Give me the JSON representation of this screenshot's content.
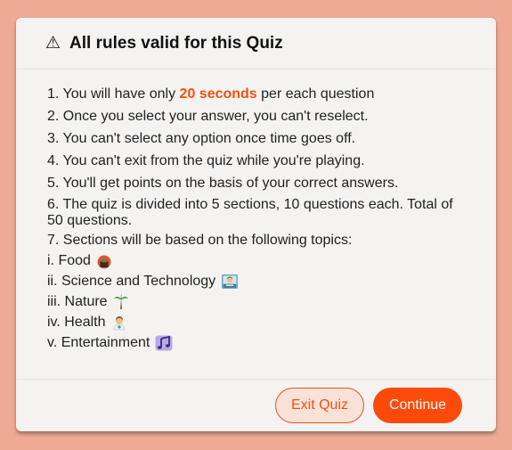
{
  "dialog": {
    "title": "All rules valid for this Quiz",
    "rules": {
      "r1_prefix": "1. You will have only ",
      "r1_highlight": "20 seconds",
      "r1_suffix": " per each question",
      "r2": "2. Once you select your answer, you can't reselect.",
      "r3": "3. You can't select any option once time goes off.",
      "r4": "4. You can't exit from the quiz while you're playing.",
      "r5": "5. You'll get points on the basis of your correct answers.",
      "r6": "6. The quiz is divided into 5 sections, 10 questions each. Total of 50 questions.",
      "r7": "7. Sections will be based on the following topics:"
    },
    "topics": [
      {
        "label": "i. Food",
        "icon": "food-icon"
      },
      {
        "label": "ii. Science and Technology",
        "icon": "technologist-icon"
      },
      {
        "label": "iii. Nature",
        "icon": "palm-tree-icon"
      },
      {
        "label": "iv. Health",
        "icon": "health-worker-icon"
      },
      {
        "label": "v. Entertainment",
        "icon": "music-notes-icon"
      }
    ],
    "buttons": {
      "exit": "Exit Quiz",
      "continue": "Continue"
    }
  },
  "colors": {
    "background": "#eeaa95",
    "accent": "#fc4a0a",
    "highlight": "#f2500f"
  }
}
